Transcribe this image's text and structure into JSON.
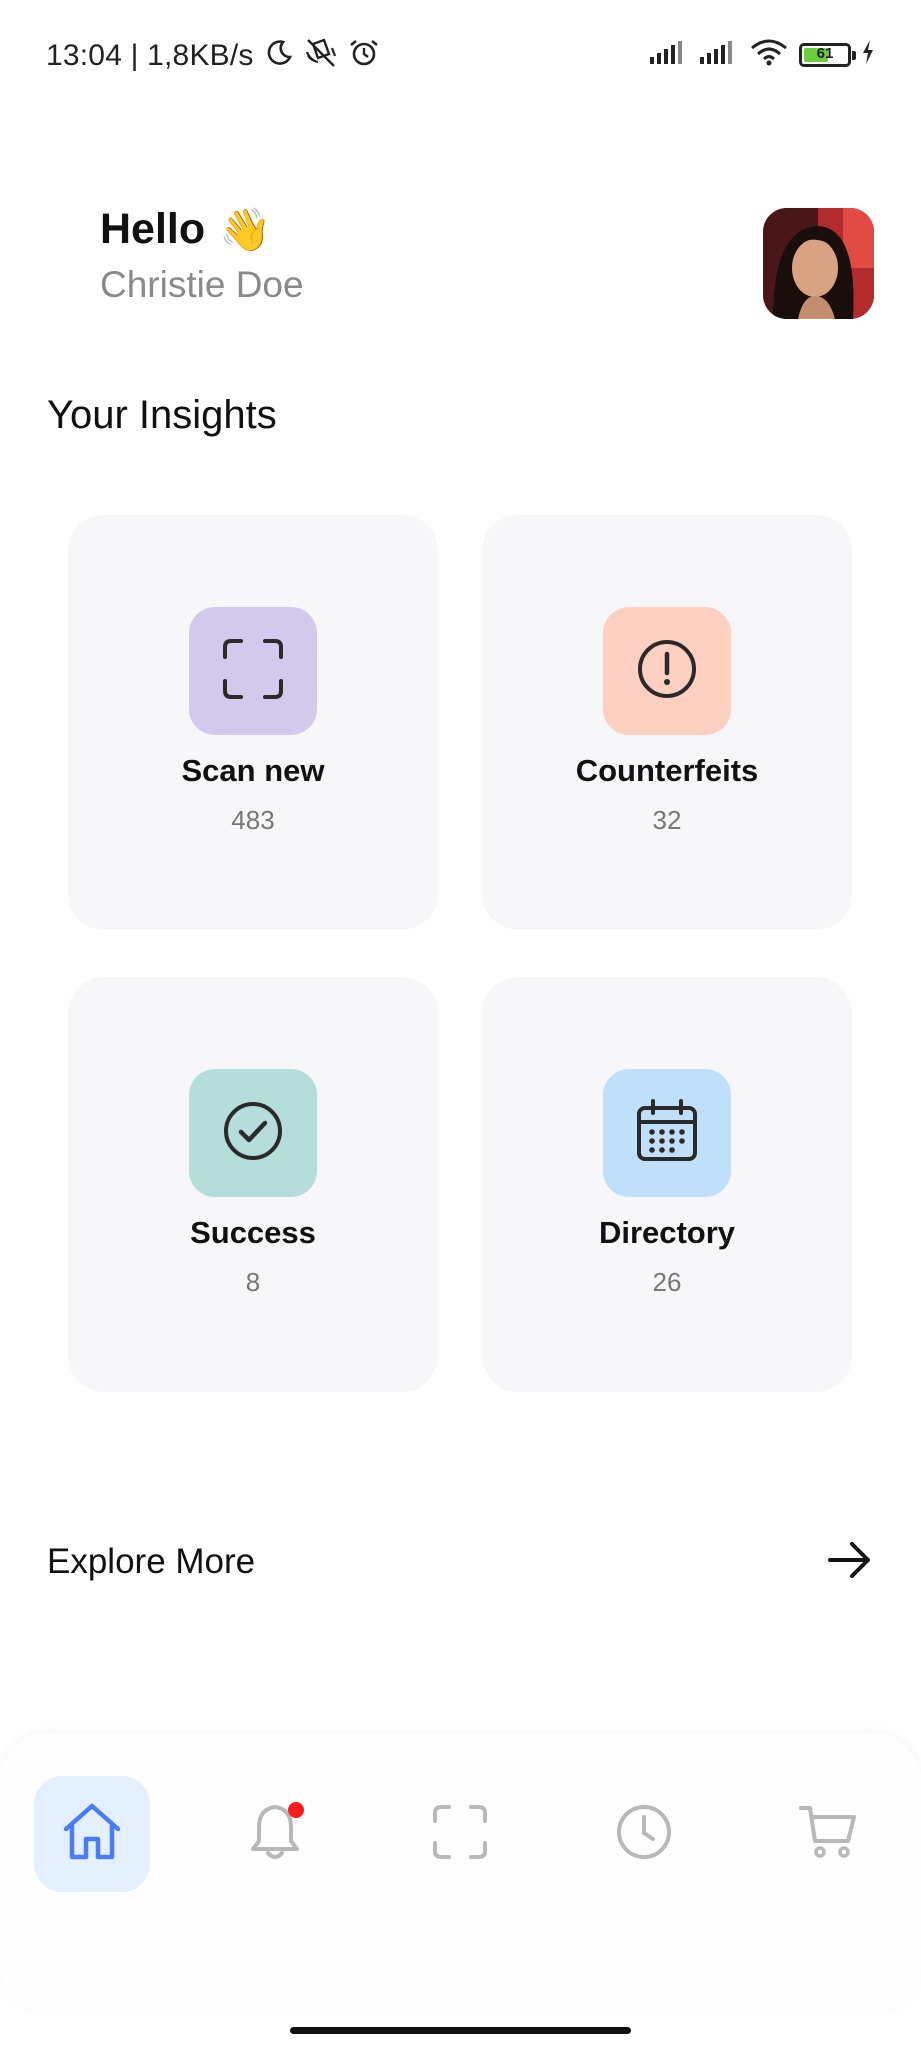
{
  "status_bar": {
    "time_speed": "13:04 | 1,8KB/s",
    "battery_percent": "61",
    "battery_level": 0.61
  },
  "greeting": {
    "hello": "Hello",
    "wave_emoji": "👋",
    "user_name": "Christie Doe"
  },
  "insights": {
    "title": "Your Insights",
    "cards": [
      {
        "label": "Scan new",
        "count": "483",
        "icon": "scan-icon",
        "color": "#d3c9ec"
      },
      {
        "label": "Counterfeits",
        "count": "32",
        "icon": "alert-circle-icon",
        "color": "#fdd0c2"
      },
      {
        "label": "Success",
        "count": "8",
        "icon": "check-circle-icon",
        "color": "#b5dedb"
      },
      {
        "label": "Directory",
        "count": "26",
        "icon": "calendar-icon",
        "color": "#c0dffb"
      }
    ]
  },
  "explore": {
    "label": "Explore More"
  },
  "bottom_nav": {
    "active": "home",
    "items": [
      "home-icon",
      "bell-icon",
      "scan-icon",
      "clock-icon",
      "cart-icon"
    ],
    "active_color": "#4a7cff",
    "inactive_color": "#b8b8b8",
    "notification_dot_color": "#ff1a1a"
  }
}
